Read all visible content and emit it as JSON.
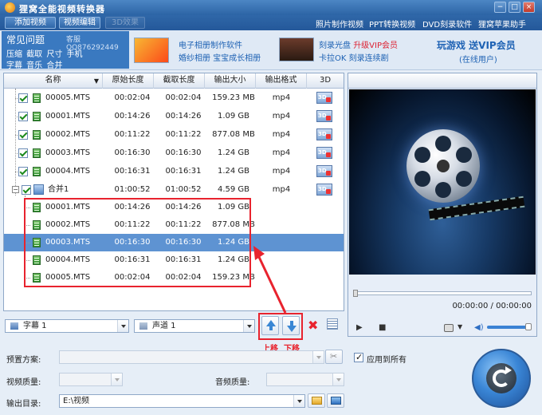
{
  "app": {
    "title": "狸窝全能视频转换器"
  },
  "window_buttons": {
    "min": "−",
    "max": "□",
    "close": "×"
  },
  "toolbar": {
    "add_video": "添加视频",
    "video_edit": "视频编辑",
    "effects_3d": "3D效果"
  },
  "links": [
    "照片制作视频",
    "PPT转换视频",
    "DVD刻录软件",
    "狸窝苹果助手"
  ],
  "faq": {
    "title": "常见问题",
    "qq": "客服QQ876292449",
    "line1": "压缩 截取 尺寸 手机",
    "line2": "字幕 音乐 合并"
  },
  "ads": {
    "album_line1": "电子相册制作软件",
    "album_line2": "婚纱相册  宝宝成长相册",
    "burn_line1": "刻录光盘",
    "burn_vip": "升级VIP会员",
    "burn_line2": "卡拉OK 刻录连续剧",
    "game_line1": "玩游戏 送VIP会员",
    "game_line2": "(在线用户)"
  },
  "table": {
    "columns": [
      "名称",
      "原始长度",
      "截取长度",
      "输出大小",
      "输出格式",
      "3D"
    ],
    "files": [
      {
        "name": "00005.MTS",
        "start": "00:02:04",
        "cut": "00:02:04",
        "size": "159.23 MB",
        "fmt": "mp4"
      },
      {
        "name": "00001.MTS",
        "start": "00:14:26",
        "cut": "00:14:26",
        "size": "1.09 GB",
        "fmt": "mp4"
      },
      {
        "name": "00002.MTS",
        "start": "00:11:22",
        "cut": "00:11:22",
        "size": "877.08 MB",
        "fmt": "mp4"
      },
      {
        "name": "00003.MTS",
        "start": "00:16:30",
        "cut": "00:16:30",
        "size": "1.24 GB",
        "fmt": "mp4"
      },
      {
        "name": "00004.MTS",
        "start": "00:16:31",
        "cut": "00:16:31",
        "size": "1.24 GB",
        "fmt": "mp4"
      }
    ],
    "merge": {
      "name": "合并1",
      "start": "01:00:52",
      "cut": "01:00:52",
      "size": "4.59 GB",
      "fmt": "mp4"
    },
    "children": [
      {
        "name": "00001.MTS",
        "start": "00:14:26",
        "cut": "00:14:26",
        "size": "1.09 GB"
      },
      {
        "name": "00002.MTS",
        "start": "00:11:22",
        "cut": "00:11:22",
        "size": "877.08 MB"
      },
      {
        "name": "00003.MTS",
        "start": "00:16:30",
        "cut": "00:16:30",
        "size": "1.24 GB"
      },
      {
        "name": "00004.MTS",
        "start": "00:16:31",
        "cut": "00:16:31",
        "size": "1.24 GB"
      },
      {
        "name": "00005.MTS",
        "start": "00:02:04",
        "cut": "00:02:04",
        "size": "159.23 MB"
      }
    ],
    "selected_child": 2
  },
  "list_tools": {
    "subtitle": "字幕 1",
    "audio": "声道 1",
    "move_up_label": "上移",
    "move_down_label": "下移"
  },
  "preview": {
    "time": "00:00:00 / 00:00:00"
  },
  "settings": {
    "preset_label": "预置方案:",
    "apply_all": "应用到所有",
    "video_quality_label": "视频质量:",
    "audio_quality_label": "音频质量:",
    "output_dir_label": "输出目录:",
    "output_dir": "E:\\视频"
  },
  "colors": {
    "accent": "#3a79c0",
    "selection": "#5e93d2",
    "highlight": "#e8232e"
  }
}
